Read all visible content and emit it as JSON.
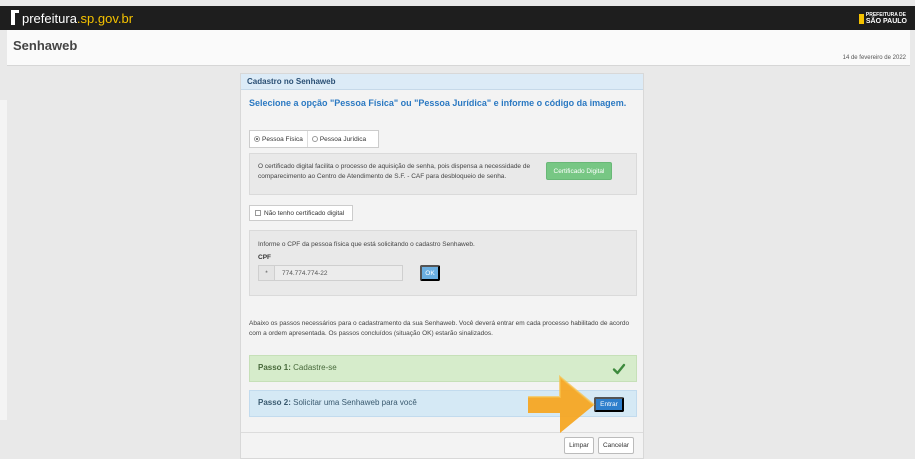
{
  "topbar": {
    "site_name": "prefeitura",
    "site_domain": ".sp.gov.br",
    "brand_small": "PREFEITURA DE",
    "brand_big": "SÃO PAULO"
  },
  "header": {
    "app_title": "Senhaweb",
    "date": "14 de fevereiro de 2022"
  },
  "panel": {
    "title": "Cadastro no Senhaweb",
    "instruction": "Selecione a opção \"Pessoa Física\" ou \"Pessoa Jurídica\" e informe o código da imagem.",
    "radio_options": [
      {
        "label": "Pessoa Física",
        "selected": true
      },
      {
        "label": "Pessoa Jurídica",
        "selected": false
      }
    ],
    "cert_text": "O certificado digital facilita o processo de aquisição de senha, pois dispensa a necessidade de comparecimento ao Centro de Atendimento de S.F. - CAF para desbloqueio de senha.",
    "cert_button": "Certificado Digital",
    "no_cert_label": "Não tenho certificado digital",
    "cpf_prompt": "Informe o CPF da pessoa física que está solicitando o cadastro Senhaweb.",
    "cpf_label": "CPF",
    "cpf_star": "*",
    "cpf_value": "774.774.774-22",
    "ok_button": "OK",
    "steps_intro": "Abaixo os passos necessários para o cadastramento da sua Senhaweb. Você deverá entrar em cada processo habilitado de acordo com a ordem apresentada. Os passos concluídos (situação OK) estarão sinalizados.",
    "steps": [
      {
        "label": "Passo 1:",
        "text": "Cadastre-se",
        "status": "done"
      },
      {
        "label": "Passo 2:",
        "text": "Solicitar uma Senhaweb para você",
        "action": "Entrar"
      }
    ],
    "footer": {
      "clear": "Limpar",
      "cancel": "Cancelar"
    }
  },
  "colors": {
    "accent_blue": "#2e7fcc",
    "success_green": "#77c784",
    "arrow_orange": "#f5a623",
    "brand_yellow": "#f5c200"
  },
  "icons": {
    "logo": "prefeitura-logo-icon",
    "step_done": "check-icon",
    "pointer": "arrow-icon"
  }
}
